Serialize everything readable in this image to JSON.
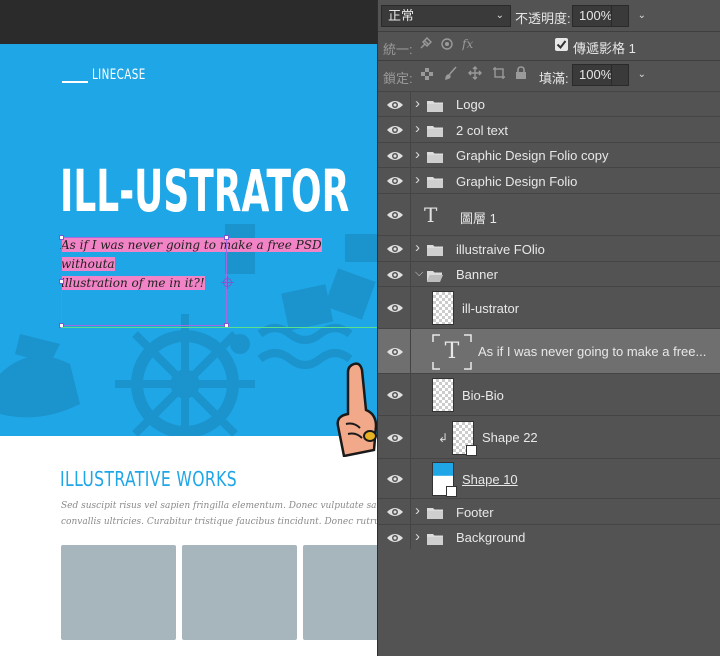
{
  "canvas": {
    "logo_text": "LINECASE",
    "hero_title": "ILL-USTRATOR",
    "subtitle_line1": "As if I was never going to make a free PSD withouta",
    "subtitle_line2": "illustration of me in it?!",
    "works_title": "ILLUSTRATIVE WORKS",
    "works_body_line1": "Sed suscipit risus vel sapien fringilla elementum. Donec vulputate sapien suscipit nulla t",
    "works_body_line2": "convallis ultricies. Curabitur tristique faucibus tincidunt. Donec rutrum mi faucibus nisi I",
    "colors": {
      "hero_blue": "#1fa6e6",
      "highlight_pink": "#f283c6",
      "card_gray": "#a7b6bd"
    }
  },
  "panel": {
    "blend_mode": "正常",
    "opacity_label": "不透明度:",
    "opacity_value": "100%",
    "unify_label": "統一:",
    "propagate_label": "傳遞影格 1",
    "propagate_checked": true,
    "lock_label": "鎖定:",
    "fill_label": "填滿:",
    "fill_value": "100%",
    "icons": {
      "unify": [
        "position-pin-icon",
        "visibility-icon",
        "fx-icon"
      ],
      "lock": [
        "lock-transparent-icon",
        "lock-brush-icon",
        "lock-move-icon",
        "lock-artboard-icon",
        "lock-all-icon"
      ]
    }
  },
  "layers": [
    {
      "name": "Logo",
      "type": "group",
      "level": 0,
      "expanded": false
    },
    {
      "name": "2 col text",
      "type": "group",
      "level": 0,
      "expanded": false
    },
    {
      "name": "Graphic Design Folio copy",
      "type": "group",
      "level": 0,
      "expanded": false
    },
    {
      "name": "Graphic Design Folio",
      "type": "group",
      "level": 0,
      "expanded": false
    },
    {
      "name": "圖層 1",
      "type": "text",
      "level": 0
    },
    {
      "name": "illustraive FOlio",
      "type": "group",
      "level": 0,
      "expanded": false
    },
    {
      "name": "Banner",
      "type": "group",
      "level": 0,
      "expanded": true
    },
    {
      "name": "ill-ustrator",
      "type": "pixel",
      "level": 1
    },
    {
      "name": "As if I was never going to make a free...",
      "type": "text",
      "level": 1,
      "selected": true
    },
    {
      "name": "Bio-Bio",
      "type": "pixel",
      "level": 1
    },
    {
      "name": "Shape 22",
      "type": "shape",
      "level": 1,
      "clipped": true
    },
    {
      "name": "Shape 10",
      "type": "shape",
      "level": 1
    },
    {
      "name": "Footer",
      "type": "group",
      "level": 0,
      "expanded": false
    },
    {
      "name": "Background",
      "type": "group",
      "level": 0,
      "expanded": false
    }
  ]
}
